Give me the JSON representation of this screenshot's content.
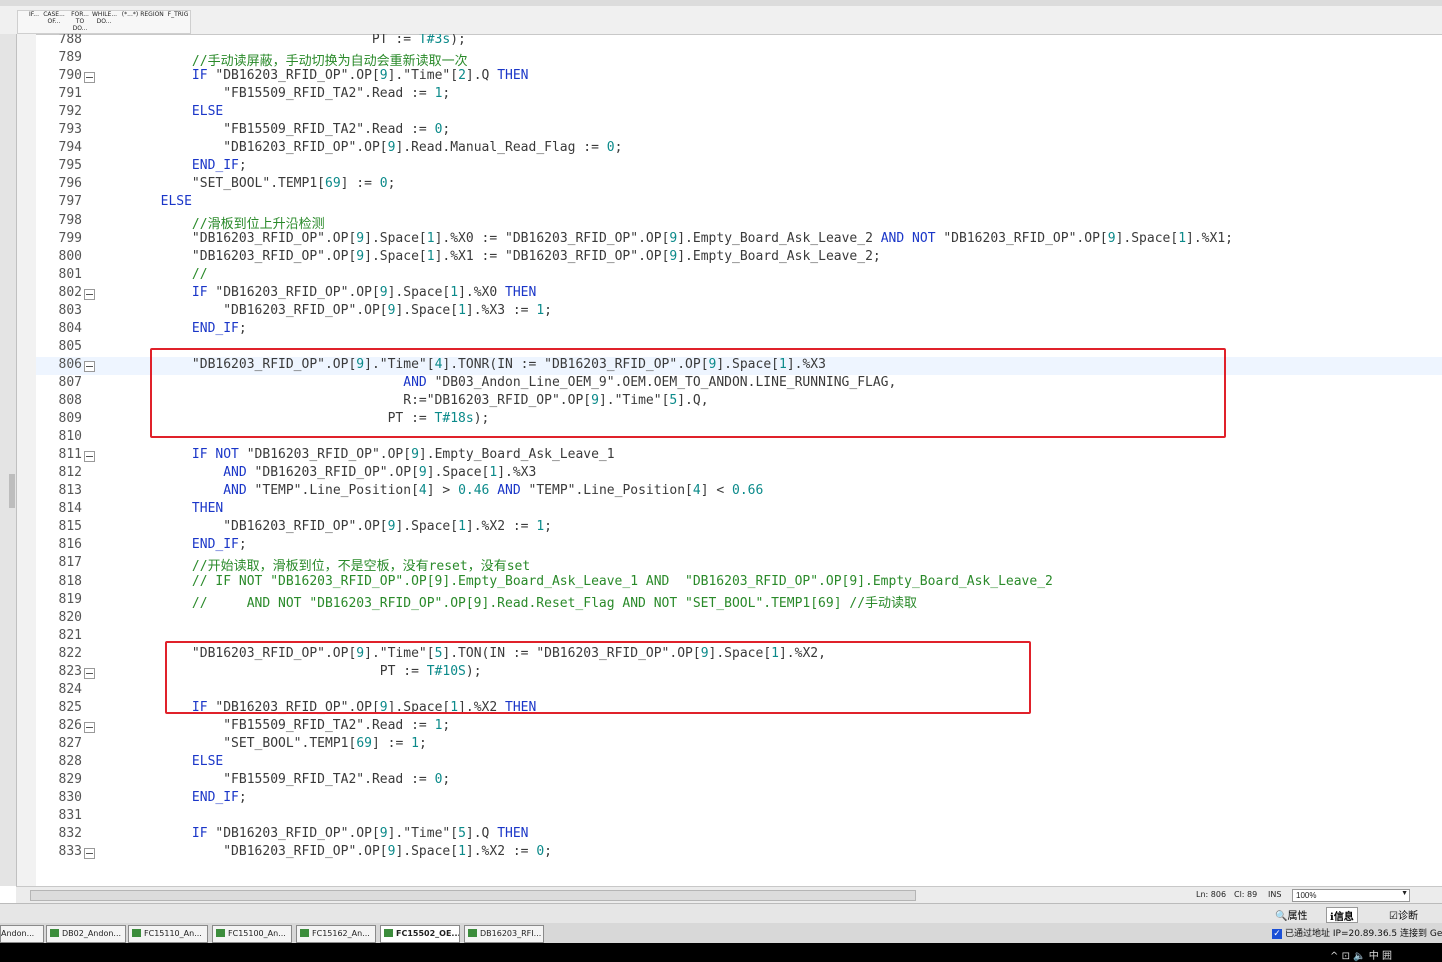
{
  "toolbar": {
    "buttons": [
      {
        "name": "if-snippet",
        "label": "IF..."
      },
      {
        "name": "case-snippet",
        "label": "CASE... OF..."
      },
      {
        "name": "for-snippet",
        "label": "FOR... TO DO..."
      },
      {
        "name": "while-snippet",
        "label": "WHILE... DO..."
      },
      {
        "name": "comment-snippet",
        "label": "(*...*)"
      },
      {
        "name": "region-snippet",
        "label": "REGION"
      },
      {
        "name": "ftrig-snippet",
        "label": "F_TRIG"
      }
    ]
  },
  "code": {
    "first_line": 788,
    "highlight_line": 806,
    "fold_lines": [
      790,
      802,
      806,
      811,
      823,
      826,
      833
    ],
    "lines": [
      "                                   PT := T#3s);",
      "            //手动读屏蔽，手动切换为自动会重新读取一次",
      "            IF \"DB16203_RFID_OP\".OP[9].\"Time\"[2].Q THEN",
      "                \"FB15509_RFID_TA2\".Read := 1;",
      "            ELSE",
      "                \"FB15509_RFID_TA2\".Read := 0;",
      "                \"DB16203_RFID_OP\".OP[9].Read.Manual_Read_Flag := 0;",
      "            END_IF;",
      "            \"SET_BOOL\".TEMP1[69] := 0;",
      "        ELSE",
      "            //滑板到位上升沿检测",
      "            \"DB16203_RFID_OP\".OP[9].Space[1].%X0 := \"DB16203_RFID_OP\".OP[9].Empty_Board_Ask_Leave_2 AND NOT \"DB16203_RFID_OP\".OP[9].Space[1].%X1;",
      "            \"DB16203_RFID_OP\".OP[9].Space[1].%X1 := \"DB16203_RFID_OP\".OP[9].Empty_Board_Ask_Leave_2;",
      "            //",
      "            IF \"DB16203_RFID_OP\".OP[9].Space[1].%X0 THEN",
      "                \"DB16203_RFID_OP\".OP[9].Space[1].%X3 := 1;",
      "            END_IF;",
      "",
      "            \"DB16203_RFID_OP\".OP[9].\"Time\"[4].TONR(IN := \"DB16203_RFID_OP\".OP[9].Space[1].%X3",
      "                                       AND \"DB03_Andon_Line_OEM_9\".OEM.OEM_TO_ANDON.LINE_RUNNING_FLAG,",
      "                                       R:=\"DB16203_RFID_OP\".OP[9].\"Time\"[5].Q,",
      "                                     PT := T#18s);",
      "",
      "            IF NOT \"DB16203_RFID_OP\".OP[9].Empty_Board_Ask_Leave_1",
      "                AND \"DB16203_RFID_OP\".OP[9].Space[1].%X3",
      "                AND \"TEMP\".Line_Position[4] > 0.46 AND \"TEMP\".Line_Position[4] < 0.66",
      "            THEN",
      "                \"DB16203_RFID_OP\".OP[9].Space[1].%X2 := 1;",
      "            END_IF;",
      "            //开始读取，滑板到位，不是空板，没有reset，没有set",
      "            // IF NOT \"DB16203_RFID_OP\".OP[9].Empty_Board_Ask_Leave_1 AND  \"DB16203_RFID_OP\".OP[9].Empty_Board_Ask_Leave_2",
      "            //     AND NOT \"DB16203_RFID_OP\".OP[9].Read.Reset_Flag AND NOT \"SET_BOOL\".TEMP1[69] //手动读取",
      "",
      "",
      "            \"DB16203_RFID_OP\".OP[9].\"Time\"[5].TON(IN := \"DB16203_RFID_OP\".OP[9].Space[1].%X2,",
      "                                    PT := T#10S);",
      "",
      "            IF \"DB16203_RFID_OP\".OP[9].Space[1].%X2 THEN",
      "                \"FB15509_RFID_TA2\".Read := 1;",
      "                \"SET_BOOL\".TEMP1[69] := 1;",
      "            ELSE",
      "                \"FB15509_RFID_TA2\".Read := 0;",
      "            END_IF;",
      "",
      "            IF \"DB16203_RFID_OP\".OP[9].\"Time\"[5].Q THEN",
      "                \"DB16203_RFID_OP\".OP[9].Space[1].%X2 := 0;"
    ]
  },
  "status": {
    "ln": "Ln: 806",
    "cl": "Cl: 89",
    "mode": "INS",
    "zoom": "100%"
  },
  "panel": {
    "properties": "属性",
    "info": "信息",
    "diagnostics": "诊断"
  },
  "taskbar": {
    "items": [
      "Andon...",
      "DB02_Andon...",
      "FC15110_An...",
      "FC15100_An...",
      "FC15162_An...",
      "FC15502_OE...",
      "DB16203_RFI..."
    ],
    "active_index": 5,
    "connection": "已通过地址 IP=20.89.36.5 连接到 Ge..."
  },
  "tray": {
    "text": "中 囲"
  },
  "colors": {
    "keyword": "#1a36c8",
    "string": "#3a3a3a",
    "comment": "#2a8a2a",
    "number": "#0b8a8a",
    "highlight_box": "#e0212a"
  }
}
